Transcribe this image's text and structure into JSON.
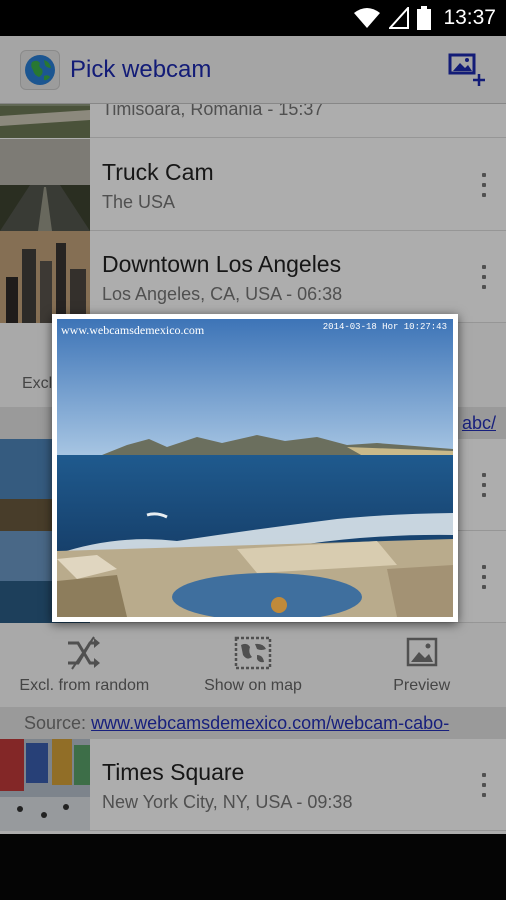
{
  "status_bar": {
    "time": "13:37"
  },
  "action_bar": {
    "title": "Pick webcam"
  },
  "webcams": [
    {
      "title": "",
      "subtitle": "Timisoara, Romania - 15:37"
    },
    {
      "title": "Truck Cam",
      "subtitle": "The USA"
    },
    {
      "title": "Downtown Los Angeles",
      "subtitle": "Los Angeles, CA, USA - 06:38"
    },
    {
      "title": "Times Square",
      "subtitle": "New York City, NY, USA - 09:38"
    }
  ],
  "expanded_top": {
    "excl_label": "Excl",
    "source_tail": "abc/"
  },
  "expanded_bottom": {
    "actions": {
      "exclude": "Excl. from random",
      "map": "Show on map",
      "preview": "Preview"
    },
    "source_label": "Source:",
    "source_url": "www.webcamsdemexico.com/webcam-cabo-"
  },
  "preview_popup": {
    "watermark": "www.webcamsdemexico.com",
    "timestamp": "2014-03-18 Hor 10:27:43"
  },
  "icons": {
    "wifi": "wifi-icon",
    "signal": "signal-icon",
    "battery": "battery-icon",
    "app": "globe-icon",
    "add": "add-image-icon",
    "exclude": "shuffle-off-icon",
    "map": "map-icon",
    "preview": "image-icon"
  },
  "colors": {
    "accent": "#1c2ab0",
    "link": "#2430b8"
  }
}
